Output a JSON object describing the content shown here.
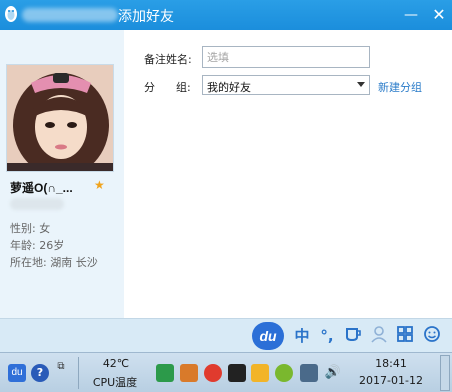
{
  "window": {
    "title": "添加好友",
    "minimize_glyph": "—",
    "close_glyph": "✕"
  },
  "profile": {
    "nickname": "萝遥O(∩_...",
    "gender_label": "性别:",
    "gender": "女",
    "age_label": "年龄:",
    "age": "26岁",
    "location_label": "所在地:",
    "location": "湖南  长沙"
  },
  "form": {
    "remark_label": "备注姓名:",
    "remark_placeholder": "选填",
    "group_label": "分      组:",
    "group_value": "我的好友",
    "new_group_link": "新建分组"
  },
  "ime_toolbar": {
    "logo": "du",
    "buttons": [
      "中",
      "°,",
      "cup-icon",
      "user-icon",
      "grid-icon",
      "smile-icon"
    ]
  },
  "taskbar": {
    "cpu_temp": "42℃",
    "cpu_label": "CPU温度",
    "time": "18:41",
    "date": "2017-01-12"
  },
  "colors": {
    "titlebar": "#1b8edc",
    "left_panel": "#eaf4fb",
    "link": "#2b7cc9",
    "star": "#f0a31d",
    "du_logo": "#2b6fd7"
  }
}
